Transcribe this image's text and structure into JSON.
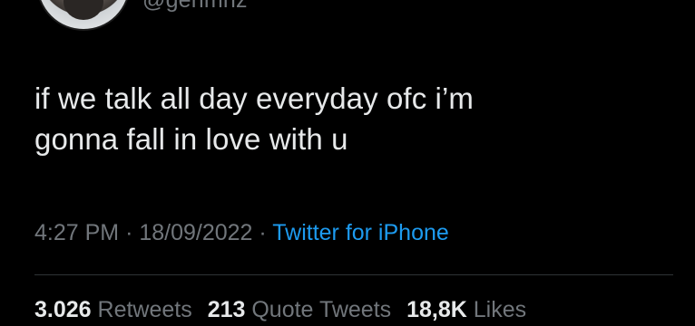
{
  "author": {
    "handle": "@genmnz"
  },
  "tweet": {
    "text_line1": "if we talk all day everyday ofc i’m",
    "text_line2": "gonna fall in love with u",
    "time": "4:27 PM",
    "separator": "·",
    "date": "18/09/2022",
    "source": "Twitter for iPhone"
  },
  "stats": {
    "retweets_count": "3.026",
    "retweets_label": "Retweets",
    "quotes_count": "213",
    "quotes_label": "Quote Tweets",
    "likes_count": "18,8K",
    "likes_label": "Likes"
  },
  "colors": {
    "background": "#000000",
    "text": "#e7e9ea",
    "muted": "#71767b",
    "link": "#1d9bf0",
    "divider": "#2f3336"
  }
}
